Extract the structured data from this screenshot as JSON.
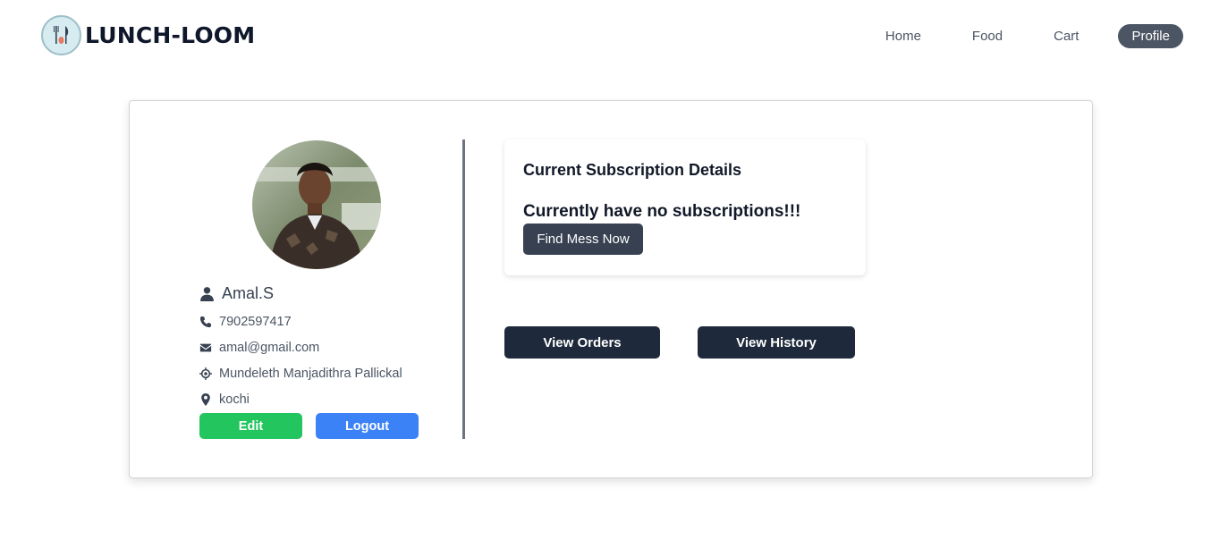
{
  "brand": {
    "name": "LUNCH-LOOM",
    "logo_icon": "fork-knife-logo-icon"
  },
  "nav": {
    "items": [
      {
        "label": "Home",
        "active": false
      },
      {
        "label": "Food",
        "active": false
      },
      {
        "label": "Cart",
        "active": false
      },
      {
        "label": "Profile",
        "active": true
      }
    ]
  },
  "profile": {
    "name": "Amal.S",
    "phone": "7902597417",
    "email": "amal@gmail.com",
    "address": "Mundeleth Manjadithra Pallickal",
    "city": "kochi",
    "edit_label": "Edit",
    "logout_label": "Logout"
  },
  "subscription": {
    "title": "Current Subscription Details",
    "status": "Currently have no subscriptions!!!",
    "find_label": "Find Mess Now"
  },
  "actions": {
    "orders_label": "View Orders",
    "history_label": "View History"
  },
  "colors": {
    "edit": "#22c55e",
    "logout": "#3b82f6",
    "dark_button": "#1e293b",
    "active_nav": "#4b5563"
  }
}
